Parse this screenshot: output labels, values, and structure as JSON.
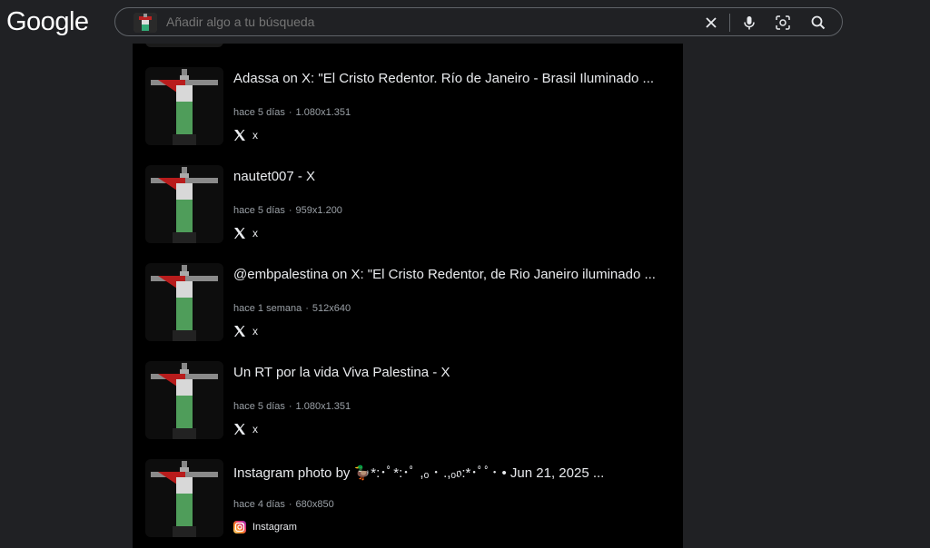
{
  "logo": "Google",
  "search": {
    "placeholder": "Añadir algo a tu búsqueda"
  },
  "icons": {
    "clear": "close-icon",
    "mic": "microphone-icon",
    "lens": "lens-icon",
    "search": "search-icon"
  },
  "results": [
    {
      "title": "Adassa on X: \"El Cristo Redentor. Río de Janeiro - Brasil Iluminado ...",
      "age": "hace 5 días",
      "size": "1.080x1.351",
      "source": "x",
      "source_icon": "x-logo-icon"
    },
    {
      "title": "nautet007 - X",
      "age": "hace 5 días",
      "size": "959x1.200",
      "source": "x",
      "source_icon": "x-logo-icon"
    },
    {
      "title": "@embpalestina on X: \"El Cristo Redentor, de Rio Janeiro iluminado ...",
      "age": "hace 1 semana",
      "size": "512x640",
      "source": "x",
      "source_icon": "x-logo-icon"
    },
    {
      "title": "Un RT por la vida Viva Palestina - X",
      "age": "hace 5 días",
      "size": "1.080x1.351",
      "source": "x",
      "source_icon": "x-logo-icon"
    },
    {
      "title": "Instagram photo by 🦆*:･ﾟ*:･ﾟ ,ₒ ･ .,ₒ𝔬:*･ﾟﾟ･ • Jun 21, 2025 ...",
      "age": "hace 4 días",
      "size": "680x850",
      "source": "Instagram",
      "source_icon": "instagram-icon"
    }
  ],
  "colors": {
    "page_bg": "#202124",
    "results_bg": "#000000",
    "meta_text": "#9aa0a6",
    "title_text": "#e8eaed"
  }
}
